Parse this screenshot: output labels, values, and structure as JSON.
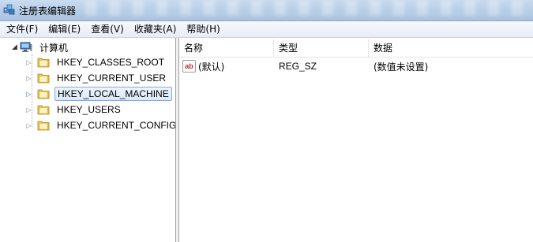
{
  "window": {
    "title": "注册表编辑器"
  },
  "menu": {
    "items": [
      "文件(F)",
      "编辑(E)",
      "查看(V)",
      "收藏夹(A)",
      "帮助(H)"
    ]
  },
  "tree": {
    "root_label": "计算机",
    "items": [
      {
        "label": "HKEY_CLASSES_ROOT",
        "selected": false
      },
      {
        "label": "HKEY_CURRENT_USER",
        "selected": false
      },
      {
        "label": "HKEY_LOCAL_MACHINE",
        "selected": true
      },
      {
        "label": "HKEY_USERS",
        "selected": false
      },
      {
        "label": "HKEY_CURRENT_CONFIG",
        "selected": false
      }
    ]
  },
  "list": {
    "columns": [
      "名称",
      "类型",
      "数据"
    ],
    "rows": [
      {
        "name": "(默认)",
        "type": "REG_SZ",
        "data": "(数值未设置)",
        "icon": "ab"
      }
    ]
  },
  "colors": {
    "selection_border": "#84acdd",
    "selection_fill": "#d9e8fb",
    "string_icon_text": "#c0272d",
    "folder_yellow": "#f3d061"
  }
}
